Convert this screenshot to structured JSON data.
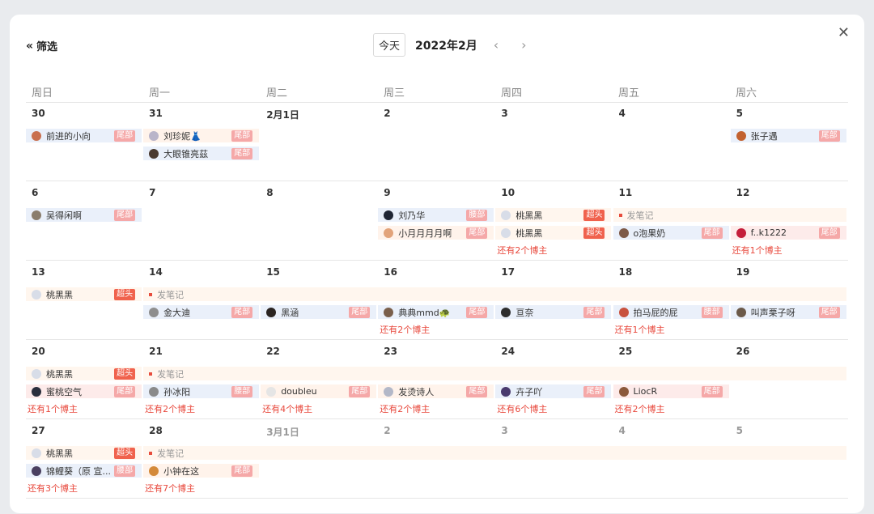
{
  "header": {
    "filter_label": "筛选",
    "today_label": "今天",
    "month_title": "2022年2月",
    "prev_icon": "chevron-left-icon",
    "next_icon": "chevron-right-icon",
    "close_icon": "close-icon"
  },
  "weekdays": [
    "周日",
    "周一",
    "周二",
    "周三",
    "周四",
    "周五",
    "周六"
  ],
  "weeks": [
    {
      "days": [
        {
          "label": "30",
          "muted": false
        },
        {
          "label": "31",
          "muted": false
        },
        {
          "label": "2月1日",
          "muted": false
        },
        {
          "label": "2",
          "muted": false
        },
        {
          "label": "3",
          "muted": false
        },
        {
          "label": "4",
          "muted": false
        },
        {
          "label": "5",
          "muted": false
        }
      ],
      "chips": [
        {
          "col": 0,
          "span": 1,
          "row": 0,
          "style": "blue",
          "avatar": "#c9704f",
          "name": "前进的小向",
          "tag": "尾部",
          "tag_style": "tag"
        },
        {
          "col": 1,
          "span": 1,
          "row": 0,
          "style": "peach",
          "avatar": "#b9b4c9",
          "name": "刘珍妮👗",
          "tag": "尾部",
          "tag_style": "tag"
        },
        {
          "col": 1,
          "span": 1,
          "row": 1,
          "style": "blue",
          "avatar": "#4a3a30",
          "name": "大眼锥亮茲",
          "tag": "尾部",
          "tag_style": "tag"
        },
        {
          "col": 6,
          "span": 1,
          "row": 0,
          "style": "blue",
          "avatar": "#c2612f",
          "name": "张子遇",
          "tag": "尾部",
          "tag_style": "tag"
        }
      ],
      "more": []
    },
    {
      "days": [
        {
          "label": "6",
          "muted": false
        },
        {
          "label": "7",
          "muted": false
        },
        {
          "label": "8",
          "muted": false
        },
        {
          "label": "9",
          "muted": false
        },
        {
          "label": "10",
          "muted": false
        },
        {
          "label": "11",
          "muted": false
        },
        {
          "label": "12",
          "muted": false
        }
      ],
      "chips": [
        {
          "col": 0,
          "span": 1,
          "row": 0,
          "style": "blue",
          "avatar": "#8a7d6d",
          "name": "吴得闲啊",
          "tag": "尾部",
          "tag_style": "tag"
        },
        {
          "col": 3,
          "span": 1,
          "row": 0,
          "style": "blue",
          "avatar": "#1f2533",
          "name": "刘乃华",
          "tag": "腰部",
          "tag_style": "tag"
        },
        {
          "col": 3,
          "span": 1,
          "row": 1,
          "style": "peach",
          "avatar": "#e2a37a",
          "name": "小月月月月啊",
          "tag": "尾部",
          "tag_style": "tag"
        },
        {
          "col": 4,
          "span": 1,
          "row": 0,
          "style": "cream",
          "avatar": "#d8dde8",
          "name": "桃黑黑",
          "tag": "超头",
          "tag_style": "hot"
        },
        {
          "col": 4,
          "span": 1,
          "row": 1,
          "style": "cream",
          "avatar": "#d8dde8",
          "name": "桃黑黑",
          "tag": "超头",
          "tag_style": "hot"
        },
        {
          "col": 5,
          "span": 2,
          "row": 0,
          "style": "cream",
          "avatar": "",
          "name": "发笔记",
          "tag": "",
          "tag_style": "note"
        },
        {
          "col": 5,
          "span": 1,
          "row": 1,
          "style": "blue",
          "avatar": "#7d5a48",
          "name": "o泡果奶",
          "tag": "尾部",
          "tag_style": "tag"
        },
        {
          "col": 6,
          "span": 1,
          "row": 1,
          "style": "pink",
          "avatar": "#c41e3a",
          "name": "f..k1222",
          "tag": "尾部",
          "tag_style": "tag"
        }
      ],
      "more": [
        {
          "col": 4,
          "text": "还有2个博主"
        },
        {
          "col": 6,
          "text": "还有1个博主"
        }
      ]
    },
    {
      "days": [
        {
          "label": "13",
          "muted": false
        },
        {
          "label": "14",
          "muted": false
        },
        {
          "label": "15",
          "muted": false
        },
        {
          "label": "16",
          "muted": false
        },
        {
          "label": "17",
          "muted": false
        },
        {
          "label": "18",
          "muted": false
        },
        {
          "label": "19",
          "muted": false
        }
      ],
      "chips": [
        {
          "col": 0,
          "span": 1,
          "row": 0,
          "style": "cream",
          "avatar": "#d8dde8",
          "name": "桃黑黑",
          "tag": "超头",
          "tag_style": "hot"
        },
        {
          "col": 1,
          "span": 6,
          "row": 0,
          "style": "cream",
          "avatar": "",
          "name": "发笔记",
          "tag": "",
          "tag_style": "note"
        },
        {
          "col": 1,
          "span": 1,
          "row": 1,
          "style": "blue",
          "avatar": "#8e8e8e",
          "name": "金大迪",
          "tag": "尾部",
          "tag_style": "tag"
        },
        {
          "col": 2,
          "span": 1,
          "row": 1,
          "style": "blue",
          "avatar": "#2b2522",
          "name": "黑涵",
          "tag": "尾部",
          "tag_style": "tag"
        },
        {
          "col": 3,
          "span": 1,
          "row": 1,
          "style": "blue",
          "avatar": "#7a5f4b",
          "name": "典典mmd🐢",
          "tag": "尾部",
          "tag_style": "tag"
        },
        {
          "col": 4,
          "span": 1,
          "row": 1,
          "style": "blue",
          "avatar": "#2e2e2e",
          "name": "亘奈",
          "tag": "尾部",
          "tag_style": "tag"
        },
        {
          "col": 5,
          "span": 1,
          "row": 1,
          "style": "blue",
          "avatar": "#c8523e",
          "name": "拍马屁的屁",
          "tag": "腰部",
          "tag_style": "tag"
        },
        {
          "col": 6,
          "span": 1,
          "row": 1,
          "style": "blue",
          "avatar": "#6b5a4a",
          "name": "叫声栗子呀",
          "tag": "尾部",
          "tag_style": "tag"
        }
      ],
      "more": [
        {
          "col": 3,
          "text": "还有2个博主"
        },
        {
          "col": 5,
          "text": "还有1个博主"
        }
      ]
    },
    {
      "days": [
        {
          "label": "20",
          "muted": false
        },
        {
          "label": "21",
          "muted": false
        },
        {
          "label": "22",
          "muted": false
        },
        {
          "label": "23",
          "muted": false
        },
        {
          "label": "24",
          "muted": false
        },
        {
          "label": "25",
          "muted": false
        },
        {
          "label": "26",
          "muted": false
        }
      ],
      "chips": [
        {
          "col": 0,
          "span": 1,
          "row": 0,
          "style": "cream",
          "avatar": "#d8dde8",
          "name": "桃黑黑",
          "tag": "超头",
          "tag_style": "hot"
        },
        {
          "col": 1,
          "span": 6,
          "row": 0,
          "style": "cream",
          "avatar": "",
          "name": "发笔记",
          "tag": "",
          "tag_style": "note"
        },
        {
          "col": 0,
          "span": 1,
          "row": 1,
          "style": "pink",
          "avatar": "#2a2f3d",
          "name": "蜜桃空气",
          "tag": "尾部",
          "tag_style": "tag"
        },
        {
          "col": 1,
          "span": 1,
          "row": 1,
          "style": "blue",
          "avatar": "#8a8a8a",
          "name": "孙冰阳",
          "tag": "腰部",
          "tag_style": "tag"
        },
        {
          "col": 2,
          "span": 1,
          "row": 1,
          "style": "peach",
          "avatar": "#e5e5e5",
          "name": "doubleu",
          "tag": "尾部",
          "tag_style": "tag"
        },
        {
          "col": 3,
          "span": 1,
          "row": 1,
          "style": "peach",
          "avatar": "#b3b8c8",
          "name": "发烫诗人",
          "tag": "尾部",
          "tag_style": "tag"
        },
        {
          "col": 4,
          "span": 1,
          "row": 1,
          "style": "blue",
          "avatar": "#4a3b6e",
          "name": "卉子吖",
          "tag": "尾部",
          "tag_style": "tag"
        },
        {
          "col": 5,
          "span": 1,
          "row": 1,
          "style": "pink",
          "avatar": "#8b5a3c",
          "name": "LiocR",
          "tag": "尾部",
          "tag_style": "tag"
        }
      ],
      "more": [
        {
          "col": 0,
          "text": "还有1个博主"
        },
        {
          "col": 1,
          "text": "还有2个博主"
        },
        {
          "col": 2,
          "text": "还有4个博主"
        },
        {
          "col": 3,
          "text": "还有2个博主"
        },
        {
          "col": 4,
          "text": "还有6个博主"
        },
        {
          "col": 5,
          "text": "还有2个博主"
        }
      ]
    },
    {
      "days": [
        {
          "label": "27",
          "muted": false
        },
        {
          "label": "28",
          "muted": false
        },
        {
          "label": "3月1日",
          "muted": true
        },
        {
          "label": "2",
          "muted": true
        },
        {
          "label": "3",
          "muted": true
        },
        {
          "label": "4",
          "muted": true
        },
        {
          "label": "5",
          "muted": true
        }
      ],
      "chips": [
        {
          "col": 0,
          "span": 1,
          "row": 0,
          "style": "cream",
          "avatar": "#d8dde8",
          "name": "桃黑黑",
          "tag": "超头",
          "tag_style": "hot"
        },
        {
          "col": 1,
          "span": 6,
          "row": 0,
          "style": "cream",
          "avatar": "",
          "name": "发笔记",
          "tag": "",
          "tag_style": "note"
        },
        {
          "col": 0,
          "span": 1,
          "row": 1,
          "style": "blue",
          "avatar": "#4a4060",
          "name": "锦鲤葵（原 宣...",
          "tag": "腰部",
          "tag_style": "tag"
        },
        {
          "col": 1,
          "span": 1,
          "row": 1,
          "style": "peach",
          "avatar": "#d48a3a",
          "name": "小钟在这",
          "tag": "尾部",
          "tag_style": "tag"
        }
      ],
      "more": [
        {
          "col": 0,
          "text": "还有3个博主"
        },
        {
          "col": 1,
          "text": "还有7个博主"
        }
      ]
    }
  ]
}
